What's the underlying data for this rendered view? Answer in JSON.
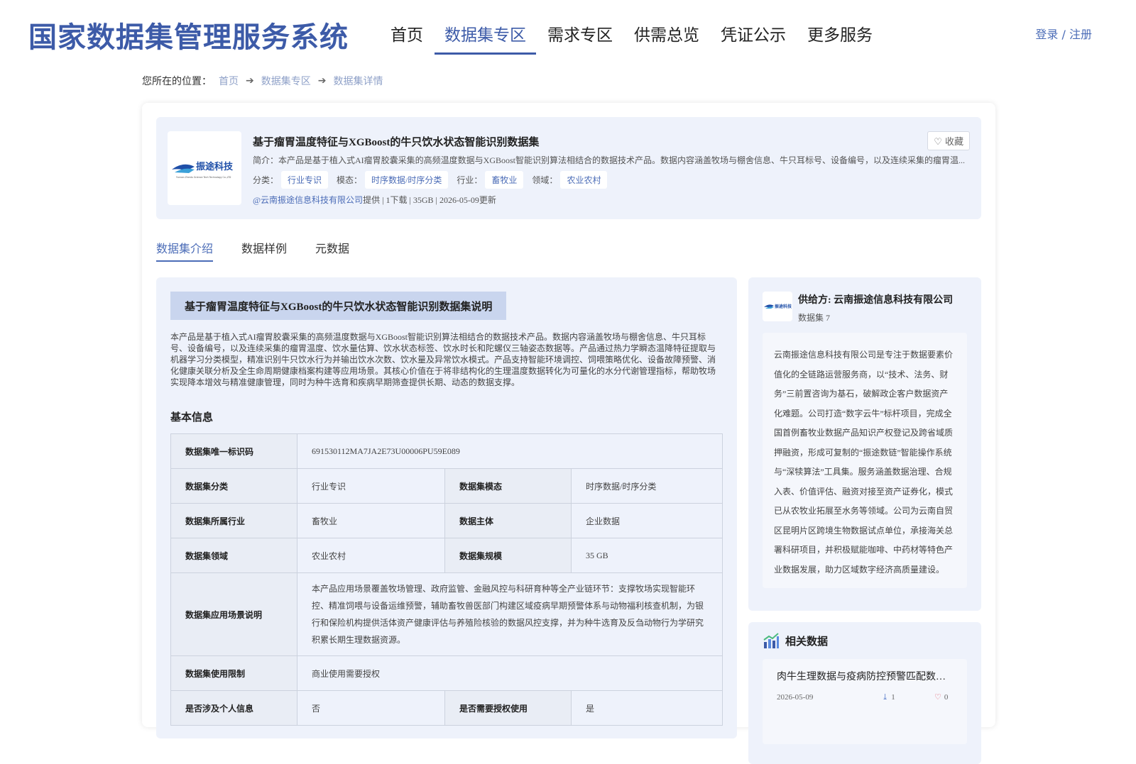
{
  "header": {
    "logo": "国家数据集管理服务系统",
    "nav": [
      "首页",
      "数据集专区",
      "需求专区",
      "供需总览",
      "凭证公示",
      "更多服务"
    ],
    "active_nav": 1,
    "login": "登录 / 注册"
  },
  "breadcrumb": {
    "label": "您所在的位置：",
    "items": [
      "首页",
      "数据集专区",
      "数据集详情"
    ]
  },
  "dataset": {
    "title": "基于瘤胃温度特征与XGBoost的牛只饮水状态智能识别数据集",
    "brief": "简介：本产品是基于植入式AI瘤胃胶囊采集的高频温度数据与XGBoost智能识别算法相结合的数据技术产品。数据内容涵盖牧场与棚舍信息、牛只耳标号、设备编号，以及连续采集的瘤胃温...",
    "favorite": "收藏",
    "logo_text": "振途科技",
    "logo_subtext": "Yunnan Zhentu Science Tech Technology Co.,LTD",
    "tags": [
      {
        "key": "分类：",
        "value": "行业专识"
      },
      {
        "key": "模态：",
        "value": "时序数据/时序分类"
      },
      {
        "key": "行业：",
        "value": "畜牧业"
      },
      {
        "key": "领域：",
        "value": "农业农村"
      }
    ],
    "provider_link": "@云南振途信息科技有限公司",
    "meta_rest": "提供  |  1下载  |  35GB  |  2026-05-09更新"
  },
  "tabs": [
    "数据集介绍",
    "数据样例",
    "元数据"
  ],
  "intro": {
    "heading": "基于瘤胃温度特征与XGBoost的牛只饮水状态智能识别数据集说明",
    "text": "本产品是基于植入式AI瘤胃胶囊采集的高频温度数据与XGBoost智能识别算法相结合的数据技术产品。数据内容涵盖牧场与棚舍信息、牛只耳标号、设备编号，以及连续采集的瘤胃温度、饮水量估算、饮水状态标签、饮水时长和陀螺仪三轴姿态数据等。产品通过热力学瞬态温降特征提取与机器学习分类模型，精准识别牛只饮水行为并输出饮水次数、饮水量及异常饮水模式。产品支持智能环境调控、饲喂策略优化、设备故障预警、消化健康关联分析及全生命周期健康档案构建等应用场景。其核心价值在于将非结构化的生理温度数据转化为可量化的水分代谢管理指标，帮助牧场实现降本增效与精准健康管理，同时为种牛选育和疾病早期筛查提供长期、动态的数据支撑。",
    "basic_title": "基本信息",
    "rows": {
      "uid_k": "数据集唯一标识码",
      "uid_v": "691530112MA7JA2E73U00006PU59E089",
      "cat_k": "数据集分类",
      "cat_v": "行业专识",
      "modal_k": "数据集模态",
      "modal_v": "时序数据/时序分类",
      "ind_k": "数据集所属行业",
      "ind_v": "畜牧业",
      "subj_k": "数据主体",
      "subj_v": "企业数据",
      "dom_k": "数据集领域",
      "dom_v": "农业农村",
      "scale_k": "数据集规模",
      "scale_v": "35 GB",
      "scene_k": "数据集应用场景说明",
      "scene_v": "本产品应用场景覆盖牧场管理、政府监管、金融风控与科研育种等全产业链环节：支撑牧场实现智能环控、精准饲喂与设备运维预警，辅助畜牧兽医部门构建区域疫病早期预警体系与动物福利核查机制，为银行和保险机构提供活体资产健康评估与养殖险核验的数据风控支撑，并为种牛选育及反刍动物行为学研究积累长期生理数据资源。",
      "limit_k": "数据集使用限制",
      "limit_v": "商业使用需要授权",
      "pi_k": "是否涉及个人信息",
      "pi_v": "否",
      "auth_k": "是否需要授权使用",
      "auth_v": "是"
    }
  },
  "provider": {
    "name": "供给方: 云南振途信息科技有限公司",
    "count": "数据集 7",
    "desc": "云南振途信息科技有限公司是专注于数据要素价值化的全链路运营服务商，以“技术、法务、财务”三前置咨询为基石，破解政企客户数据资产化难题。公司打造“数字云牛”标杆项目，完成全国首例畜牧业数据产品知识产权登记及跨省域质押融资，形成可复制的“振途数链”智能操作系统与“深犊算法”工具集。服务涵盖数据治理、合规入表、价值评估、融资对接至资产证券化，模式已从农牧业拓展至水务等领域。公司为云南自贸区昆明片区跨境生物数据试点单位，承接海关总署科研项目，并积极赋能咖啡、中药材等特色产业数据发展，助力区域数字经济高质量建设。"
  },
  "related": {
    "title": "相关数据",
    "items": [
      {
        "title": "肉牛生理数据与疫病防控预警匹配数据集",
        "date": "2026-05-09",
        "downloads": "1",
        "likes": "0"
      }
    ]
  },
  "colors": {
    "brand": "#3d5ba8",
    "accent": "#4b6cb7",
    "panel": "#eef2fb"
  }
}
